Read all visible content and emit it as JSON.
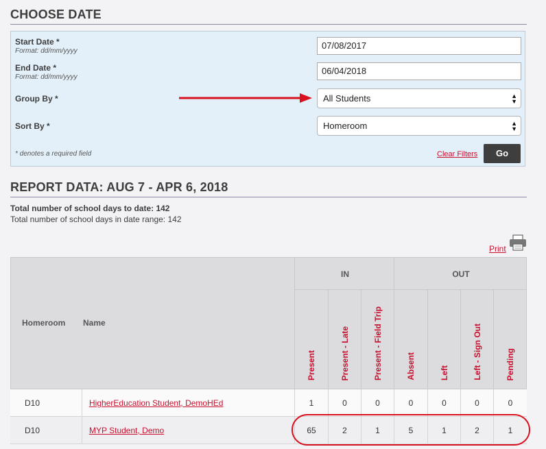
{
  "choose_date": {
    "title": "CHOOSE DATE",
    "start_label": "Start Date *",
    "start_hint": "Format: dd/mm/yyyy",
    "start_value": "07/08/2017",
    "end_label": "End Date *",
    "end_hint": "Format: dd/mm/yyyy",
    "end_value": "06/04/2018",
    "group_label": "Group By *",
    "group_value": "All Students",
    "sort_label": "Sort By *",
    "sort_value": "Homeroom",
    "required_note": "* denotes a required field",
    "clear_label": "Clear Filters",
    "go_label": "Go"
  },
  "report": {
    "title": "REPORT DATA: AUG 7 - APR 6, 2018",
    "total_days": "Total number of school days to date: 142",
    "range_days": "Total number of school days in date range: 142",
    "print_label": "Print"
  },
  "table": {
    "col_homeroom": "Homeroom",
    "col_name": "Name",
    "group_in": "IN",
    "group_out": "OUT",
    "status_cols": [
      "Present",
      "Present - Late",
      "Present - Field Trip",
      "Absent",
      "Left",
      "Left - Sign Out",
      "Pending"
    ],
    "rows": [
      {
        "homeroom": "D10",
        "name": "HigherEducation Student, DemoHEd",
        "values": [
          "1",
          "0",
          "0",
          "0",
          "0",
          "0",
          "0"
        ]
      },
      {
        "homeroom": "D10",
        "name": "MYP Student, Demo",
        "values": [
          "65",
          "2",
          "1",
          "5",
          "1",
          "2",
          "1"
        ]
      }
    ]
  },
  "colors": {
    "accent_red": "#c8102e",
    "annotation_red": "#d9101e",
    "panel_bg": "#e3f0f9"
  }
}
